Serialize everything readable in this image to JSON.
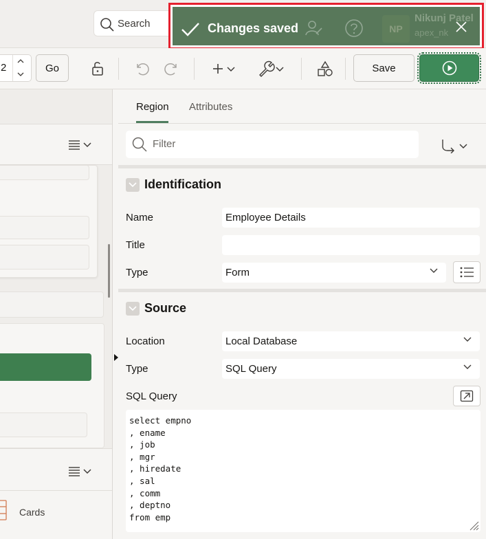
{
  "header": {
    "search_label": "Search",
    "toast_message": "Changes saved",
    "user_initials": "NP",
    "user_name": "Nikunj Patel",
    "user_workspace": "apex_nk"
  },
  "toolbar": {
    "page_number": "2",
    "go_label": "Go",
    "save_label": "Save"
  },
  "left_panel": {
    "gallery_item_label": "Cards"
  },
  "property_editor": {
    "tabs": [
      {
        "label": "Region",
        "active": true
      },
      {
        "label": "Attributes",
        "active": false
      }
    ],
    "filter_placeholder": "Filter",
    "sections": {
      "identification": {
        "title": "Identification",
        "name_label": "Name",
        "name_value": "Employee Details",
        "title_label": "Title",
        "title_value": "",
        "type_label": "Type",
        "type_value": "Form"
      },
      "source": {
        "title": "Source",
        "location_label": "Location",
        "location_value": "Local Database",
        "type_label": "Type",
        "type_value": "SQL Query",
        "sql_label": "SQL Query",
        "sql_lines": [
          "select empno",
          ", ename",
          ", job",
          ", mgr",
          ", hiredate",
          ", sal",
          ", comm",
          ", deptno",
          "from emp"
        ]
      }
    }
  },
  "colors": {
    "toast_bg": "#58785a",
    "highlight_border": "#e5202e",
    "run_button": "#3e8a59",
    "tab_underline": "#4f7d5f"
  },
  "icons": {
    "search": "search-icon",
    "toast_check": "check-icon",
    "toast_close": "close-icon",
    "run": "play-icon",
    "undo": "undo-icon",
    "redo": "redo-icon",
    "lock": "lock-icon",
    "add": "plus-icon",
    "utilities": "wrench-icon",
    "shared_components": "shapes-icon",
    "menu": "menu-icon",
    "navigate": "arrow-turn-icon",
    "collapse": "chevron-down-icon",
    "list_of_values": "list-icon",
    "code_editor": "expand-icon"
  }
}
